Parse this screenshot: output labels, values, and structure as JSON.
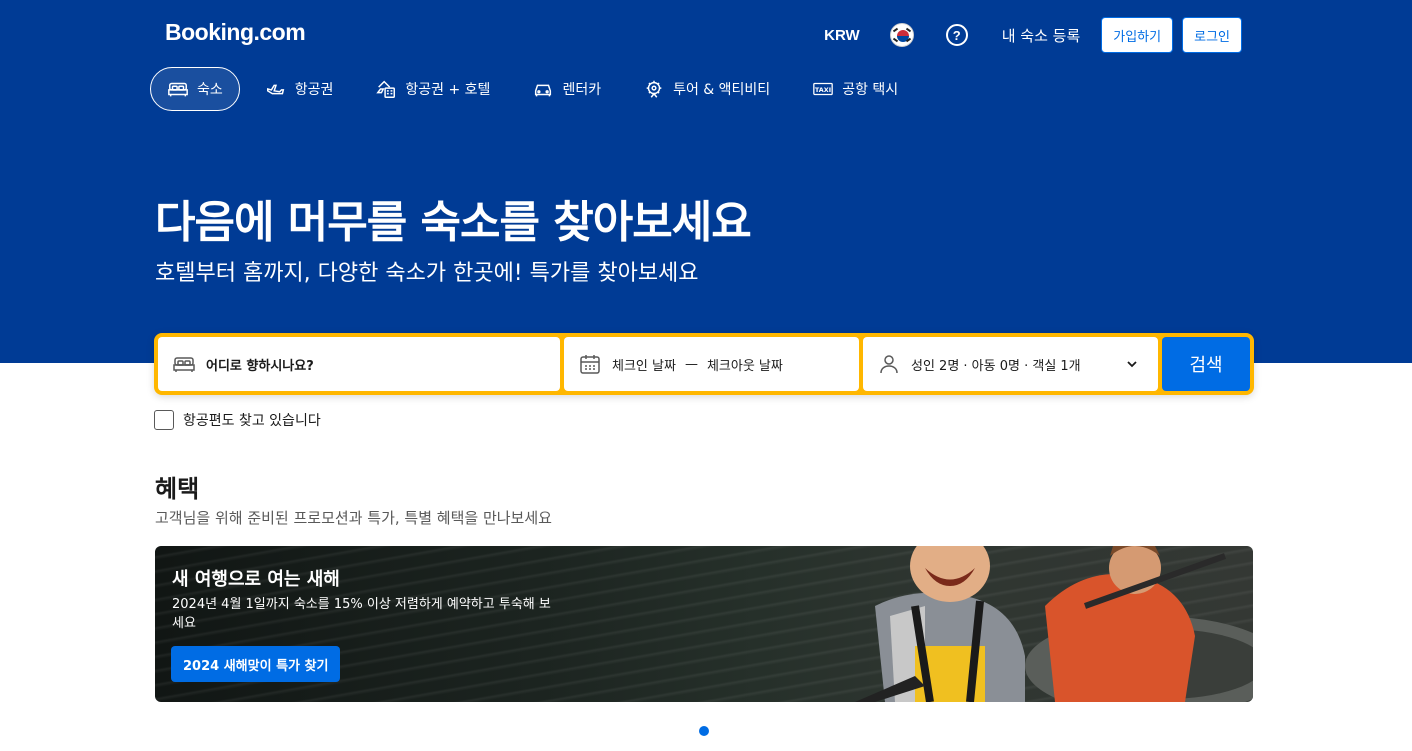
{
  "header": {
    "logo": "Booking.com",
    "currency": "KRW",
    "list_property": "내 숙소 등록",
    "register_label": "가입하기",
    "signin_label": "로그인"
  },
  "nav": [
    {
      "label": "숙소",
      "icon": "bed-icon",
      "active": true
    },
    {
      "label": "항공권",
      "icon": "plane-icon",
      "active": false
    },
    {
      "label": "항공권 + 호텔",
      "icon": "flight-hotel-icon",
      "active": false
    },
    {
      "label": "렌터카",
      "icon": "car-icon",
      "active": false
    },
    {
      "label": "투어 & 액티비티",
      "icon": "attractions-icon",
      "active": false
    },
    {
      "label": "공항 택시",
      "icon": "taxi-icon",
      "active": false
    }
  ],
  "hero": {
    "title": "다음에 머무를 숙소를 찾아보세요",
    "subtitle": "호텔부터 홈까지, 다양한 숙소가 한곳에! 특가를 찾아보세요"
  },
  "search": {
    "destination_placeholder": "어디로 향하시나요?",
    "checkin": "체크인 날짜",
    "dash": "—",
    "checkout": "체크아웃 날짜",
    "guests": "성인 2명 · 아동 0명 · 객실 1개",
    "search_label": "검색",
    "flight_checkbox_label": "항공편도 찾고 있습니다"
  },
  "deals": {
    "title": "혜택",
    "subtitle": "고객님을 위해 준비된 프로모션과 특가, 특별 혜택을 만나보세요",
    "promo": {
      "title": "새 여행으로 여는 새해",
      "text": "2024년 4월 1일까지 숙소를 15% 이상 저렴하게 예약하고 투숙해 보세요",
      "button": "2024 새해맞이 특가 찾기"
    }
  },
  "colors": {
    "brand_blue": "#003b95",
    "action_blue": "#006ce4",
    "search_border": "#ffb700"
  }
}
